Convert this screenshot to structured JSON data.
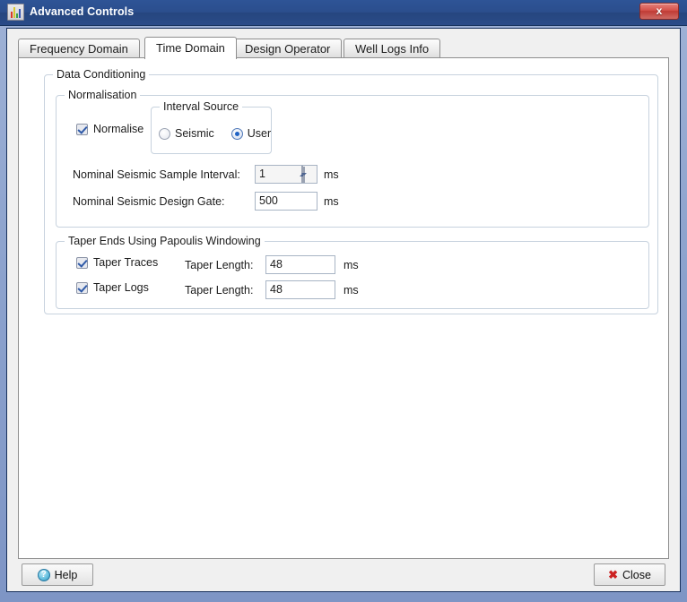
{
  "window": {
    "title": "Advanced Controls",
    "icon": "bar-chart-icon",
    "close_label": "x",
    "frame_color": "#2b4e8d"
  },
  "tabs": [
    {
      "label": "Frequency Domain",
      "active": false
    },
    {
      "label": "Time Domain",
      "active": true
    },
    {
      "label": "Design Operator",
      "active": false
    },
    {
      "label": "Well Logs Info",
      "active": false
    }
  ],
  "groups": {
    "data_conditioning": {
      "legend": "Data Conditioning"
    },
    "normalisation": {
      "legend": "Normalisation"
    },
    "interval_source": {
      "legend": "Interval Source"
    },
    "taper": {
      "legend": "Taper Ends Using Papoulis Windowing"
    }
  },
  "normalisation": {
    "normalise_checkbox": {
      "label": "Normalise",
      "checked": true
    },
    "interval_source": {
      "options": [
        {
          "label": "Seismic",
          "selected": false
        },
        {
          "label": "User",
          "selected": true
        }
      ]
    },
    "sample_interval": {
      "label": "Nominal Seismic Sample Interval:",
      "value": "1",
      "unit": "ms"
    },
    "design_gate": {
      "label": "Nominal Seismic Design Gate:",
      "value": "500",
      "unit": "ms"
    }
  },
  "taper": {
    "rows": [
      {
        "checkbox_label": "Taper Traces",
        "checked": true,
        "length_label": "Taper Length:",
        "length_value": "48",
        "unit": "ms"
      },
      {
        "checkbox_label": "Taper Logs",
        "checked": true,
        "length_label": "Taper Length:",
        "length_value": "48",
        "unit": "ms"
      }
    ]
  },
  "footer": {
    "help_label": "Help",
    "close_label": "Close",
    "help_icon": "question-circle-icon",
    "close_icon": "red-x-icon"
  }
}
